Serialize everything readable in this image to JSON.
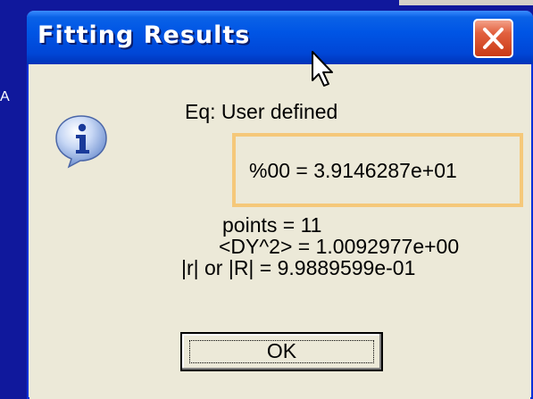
{
  "background": {
    "left_edge_text": "A"
  },
  "dialog": {
    "title": "Fitting Results",
    "close_icon": "close-icon",
    "info_icon": "info-icon",
    "equation_label": "Eq: User defined",
    "result": "%00 = 3.9146287e+01",
    "stats": {
      "points": "points = 11",
      "dy2": "<DY^2> = 1.0092977e+00",
      "r": "|r| or |R| = 9.9889599e-01"
    },
    "ok_label": "OK"
  },
  "colors": {
    "desktop": "#10189c",
    "titlebar": "#0055e5",
    "close_button": "#d9542f",
    "dialog_face": "#ece9d8",
    "highlight": "#f5c87a"
  }
}
